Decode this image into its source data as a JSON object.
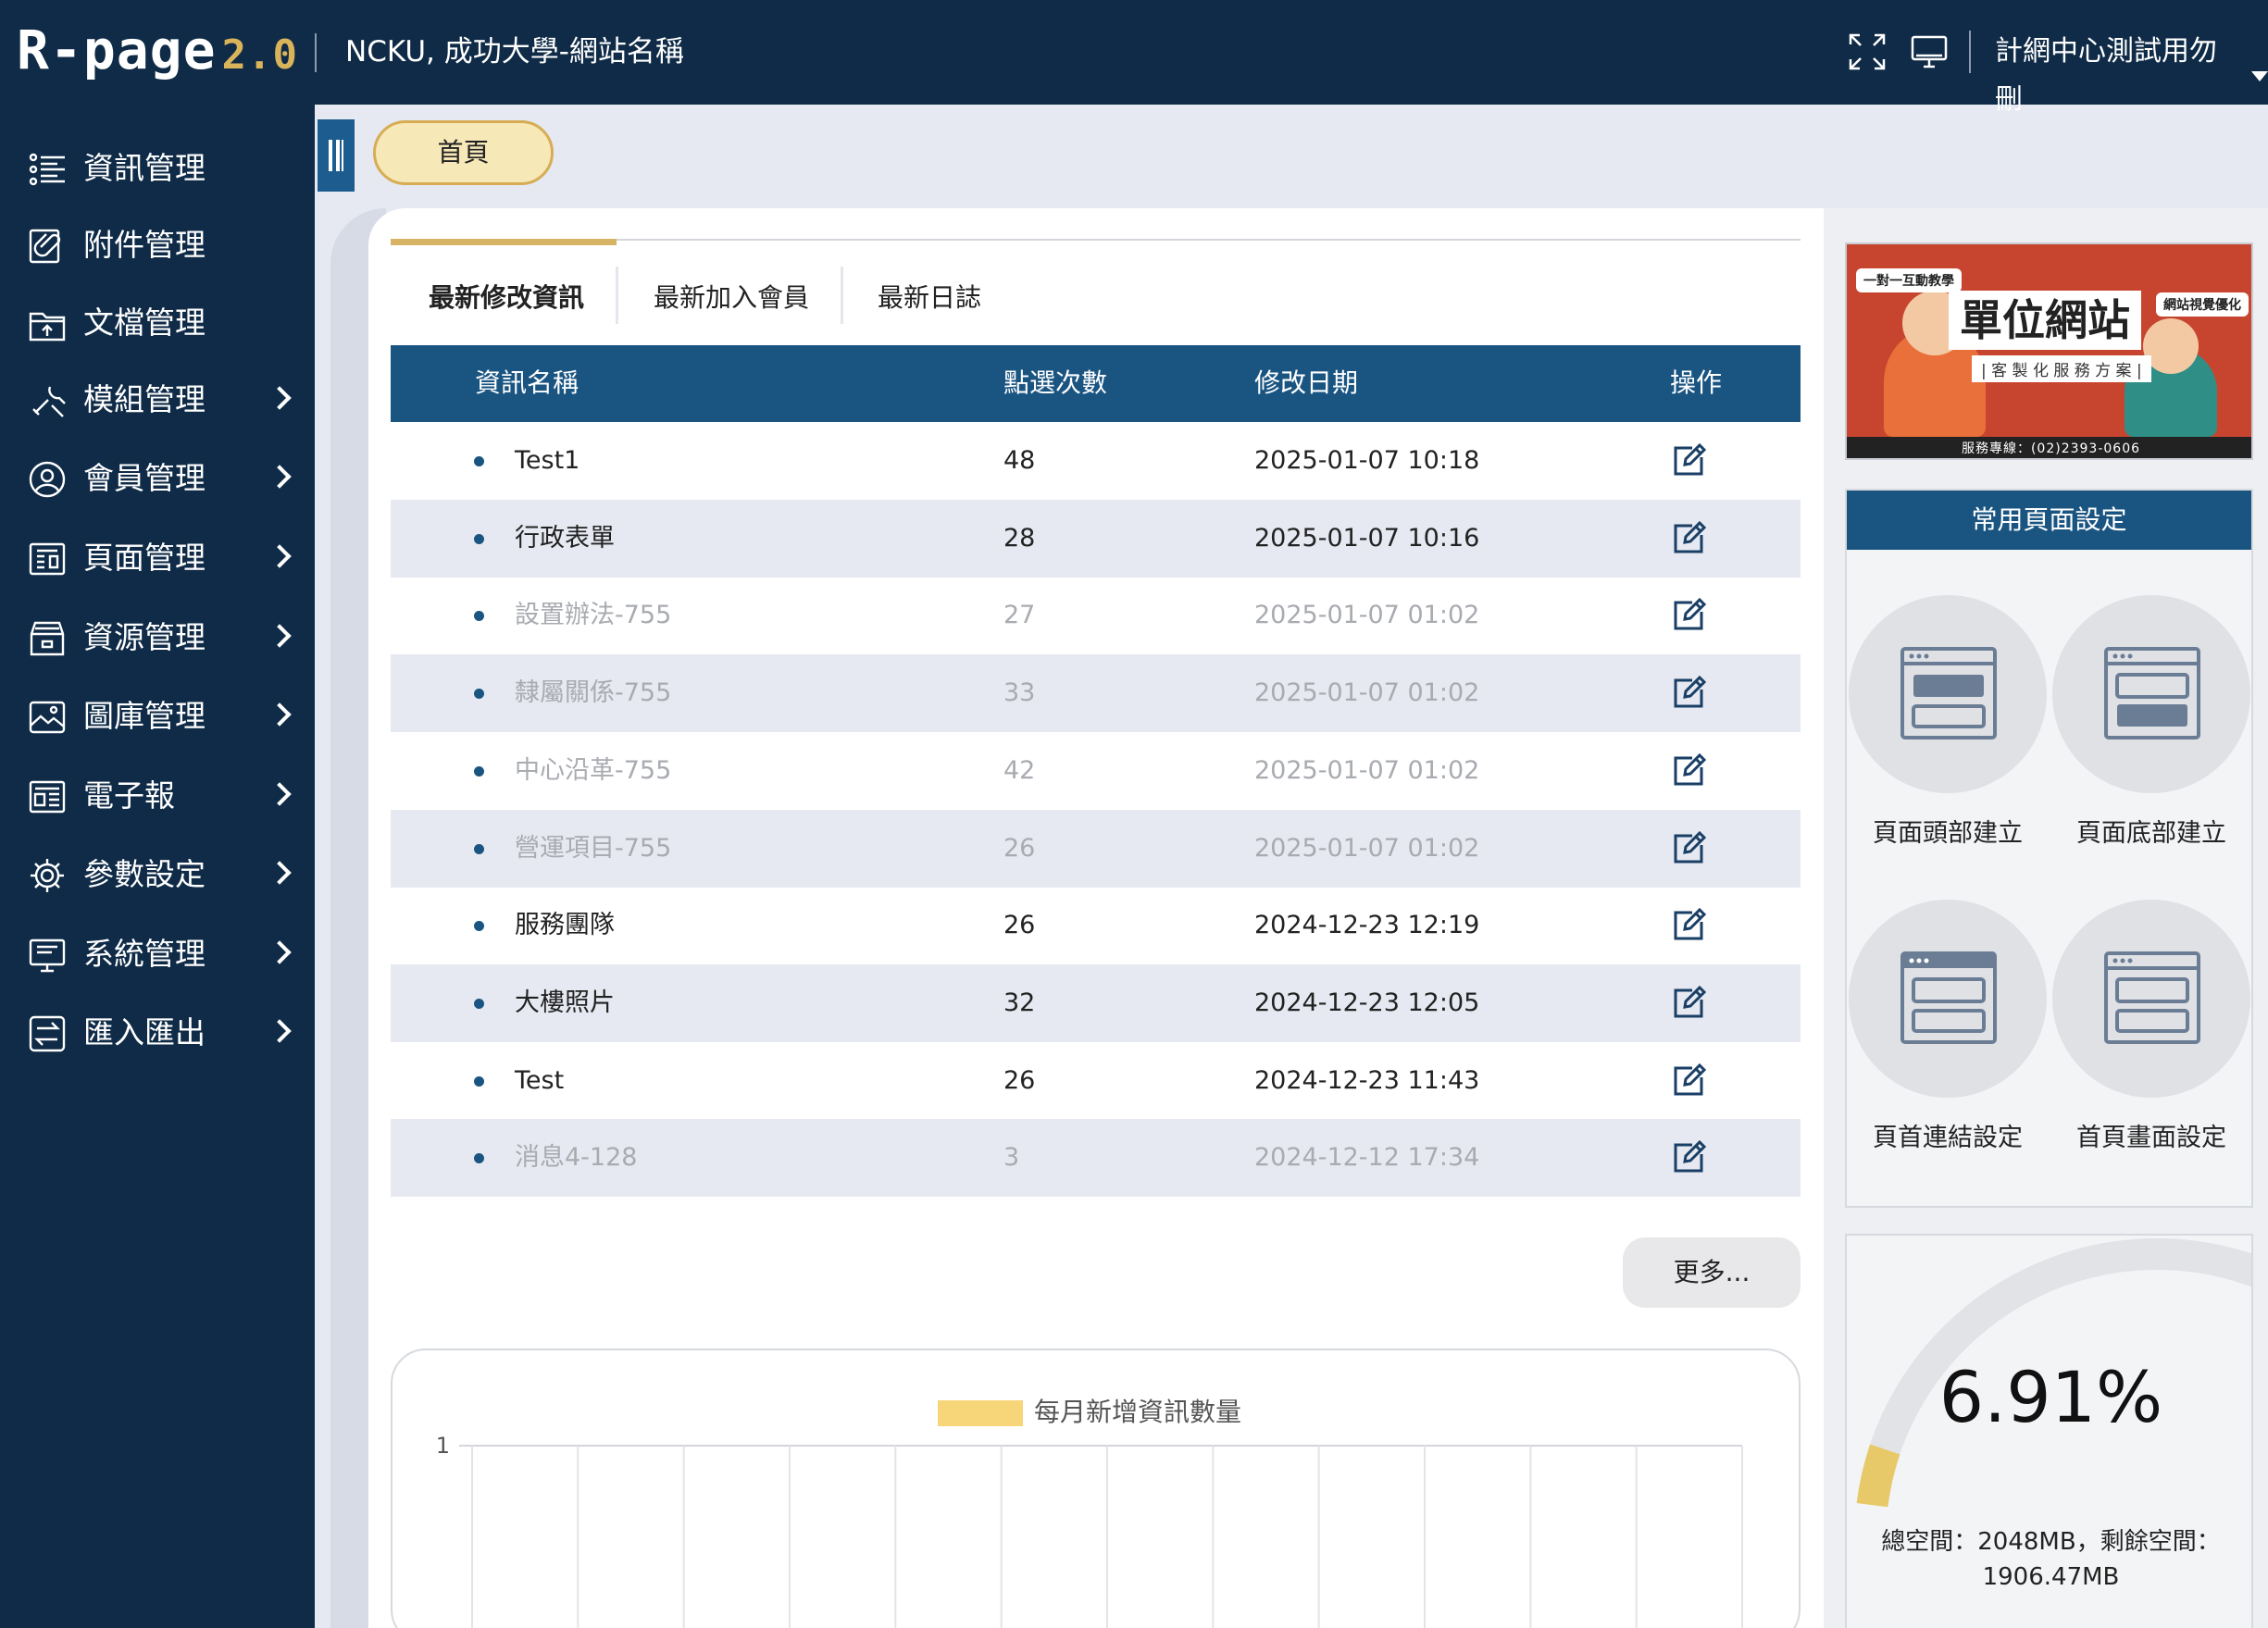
{
  "app": {
    "logo_main": "R-page",
    "logo_version": "2.0",
    "site_title": "NCKU, 成功大學-網站名稱",
    "user_name": "計網中心測試用勿刪"
  },
  "sidebar": {
    "items": [
      {
        "label": "資訊管理",
        "icon": "list-icon",
        "has_sub": false
      },
      {
        "label": "附件管理",
        "icon": "attachment-icon",
        "has_sub": false
      },
      {
        "label": "文檔管理",
        "icon": "folder-upload-icon",
        "has_sub": false
      },
      {
        "label": "模組管理",
        "icon": "tools-icon",
        "has_sub": true
      },
      {
        "label": "會員管理",
        "icon": "user-circle-icon",
        "has_sub": true
      },
      {
        "label": "頁面管理",
        "icon": "page-layout-icon",
        "has_sub": true
      },
      {
        "label": "資源管理",
        "icon": "archive-box-icon",
        "has_sub": true
      },
      {
        "label": "圖庫管理",
        "icon": "image-gallery-icon",
        "has_sub": true
      },
      {
        "label": "電子報",
        "icon": "newsletter-icon",
        "has_sub": true
      },
      {
        "label": "參數設定",
        "icon": "gear-icon",
        "has_sub": true
      },
      {
        "label": "系統管理",
        "icon": "monitor-icon",
        "has_sub": true
      },
      {
        "label": "匯入匯出",
        "icon": "import-export-icon",
        "has_sub": true
      }
    ]
  },
  "breadcrumb": {
    "home": "首頁"
  },
  "tabs": [
    {
      "label": "最新修改資訊",
      "active": true
    },
    {
      "label": "最新加入會員",
      "active": false
    },
    {
      "label": "最新日誌",
      "active": false
    }
  ],
  "table": {
    "headers": [
      "資訊名稱",
      "點選次數",
      "修改日期",
      "操作"
    ],
    "rows": [
      {
        "name": "Test1",
        "clicks": "48",
        "date": "2025-01-07 10:18",
        "dim": false
      },
      {
        "name": "行政表單",
        "clicks": "28",
        "date": "2025-01-07 10:16",
        "dim": false
      },
      {
        "name": "設置辦法-755",
        "clicks": "27",
        "date": "2025-01-07 01:02",
        "dim": true
      },
      {
        "name": "隸屬關係-755",
        "clicks": "33",
        "date": "2025-01-07 01:02",
        "dim": true
      },
      {
        "name": "中心沿革-755",
        "clicks": "42",
        "date": "2025-01-07 01:02",
        "dim": true
      },
      {
        "name": "營運項目-755",
        "clicks": "26",
        "date": "2025-01-07 01:02",
        "dim": true
      },
      {
        "name": "服務團隊",
        "clicks": "26",
        "date": "2024-12-23 12:19",
        "dim": false
      },
      {
        "name": "大樓照片",
        "clicks": "32",
        "date": "2024-12-23 12:05",
        "dim": false
      },
      {
        "name": "Test",
        "clicks": "26",
        "date": "2024-12-23 11:43",
        "dim": false
      },
      {
        "name": "消息4-128",
        "clicks": "3",
        "date": "2024-12-12 17:34",
        "dim": true
      }
    ],
    "more_label": "更多..."
  },
  "chart_data": {
    "type": "bar",
    "title": "",
    "series": [
      {
        "name": "每月新增資訊數量",
        "color": "#f7d67a",
        "values": []
      }
    ],
    "y_ticks": [
      "1"
    ],
    "ylim": [
      0,
      1
    ],
    "grid": true,
    "legend": "top-center"
  },
  "banner": {
    "tag_left": "一對一互動教學",
    "title": "單位網站",
    "tag_right": "網站視覺優化",
    "subtitle": "| 客 製 化 服 務 方 案 |",
    "footer": "服務專線：(02)2393-0606"
  },
  "quick_settings": {
    "title": "常用頁面設定",
    "items": [
      {
        "label": "頁面頭部建立",
        "icon": "page-header-icon"
      },
      {
        "label": "頁面底部建立",
        "icon": "page-footer-icon"
      },
      {
        "label": "頁首連結設定",
        "icon": "header-link-icon"
      },
      {
        "label": "首頁畫面設定",
        "icon": "homepage-layout-icon"
      }
    ]
  },
  "storage": {
    "percent_label": "6.91%",
    "percent_value": 6.91,
    "total_label": "總空間：2048MB，剩餘空間：",
    "remaining_label": "1906.47MB",
    "gauge_color": "#e8c96a"
  }
}
